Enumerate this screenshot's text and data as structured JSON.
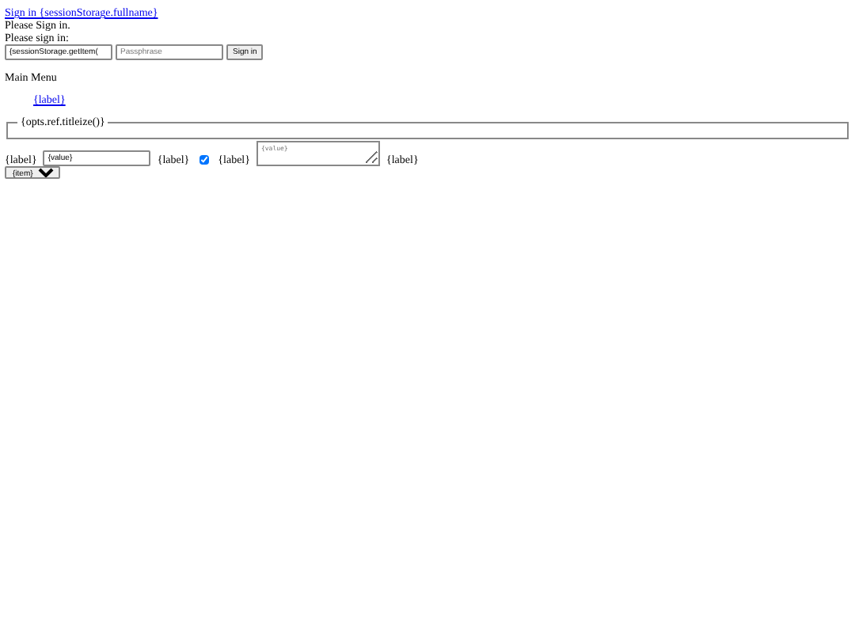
{
  "header_link": "Sign in {sessionStorage.fullname}",
  "messages": [
    "Please Sign in.",
    "Please sign in:"
  ],
  "login": {
    "username_value": "{sessionStorage.getItem(",
    "passphrase_placeholder": "Passphrase",
    "button": "Sign in"
  },
  "menu": {
    "title": "Main Menu",
    "items": [
      "{label}"
    ]
  },
  "fieldset": {
    "legend": "{opts.ref.titleize()}"
  },
  "form_row": {
    "items": [
      {
        "kind": "label",
        "text": "{label}"
      },
      {
        "kind": "input",
        "value": "{value}"
      },
      {
        "kind": "label",
        "text": "{label}"
      },
      {
        "kind": "checkbox",
        "checked": true
      },
      {
        "kind": "label",
        "text": "{label}"
      },
      {
        "kind": "textarea",
        "placeholder": "{value}"
      },
      {
        "kind": "label",
        "text": "{label}"
      }
    ]
  },
  "select": {
    "value": "{item}"
  }
}
